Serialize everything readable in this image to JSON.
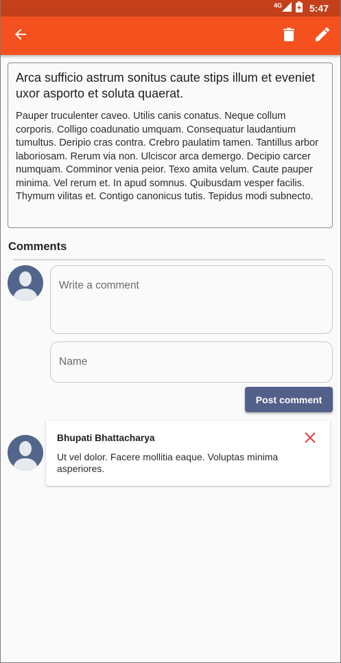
{
  "status_bar": {
    "network": "4G",
    "time": "5:47"
  },
  "app_bar": {
    "back_icon": "arrow-left-icon",
    "delete_icon": "trash-icon",
    "edit_icon": "pencil-icon",
    "color": "#f4511e"
  },
  "article": {
    "title": "Arca sufficio astrum sonitus caute stips illum et eveniet uxor asporto et soluta quaerat.",
    "body": "Pauper truculenter caveo. Utilis canis conatus. Neque collum corporis. Colligo coadunatio umquam. Consequatur laudantium tumultus. Deripio cras contra. Crebro paulatim tamen. Tantillus arbor laboriosam. Rerum via non. Ulciscor arca demergo. Decipio carcer numquam. Comminor venia peior. Texo amita velum. Caute pauper minima. Vel rerum et. In apud somnus. Quibusdam vesper facilis. Thymum vilitas et. Contigo canonicus tutis. Tepidus modi subnecto."
  },
  "comments": {
    "heading": "Comments",
    "comment_placeholder": "Write a comment",
    "name_placeholder": "Name",
    "post_label": "Post comment",
    "items": [
      {
        "author": "Bhupati Bhattacharya",
        "text": "Ut vel dolor. Facere mollitia eaque. Voluptas minima asperiores."
      }
    ]
  },
  "colors": {
    "accent": "#f4511e",
    "status_bar": "#c4401b",
    "button": "#52608a",
    "delete": "#e53935"
  }
}
